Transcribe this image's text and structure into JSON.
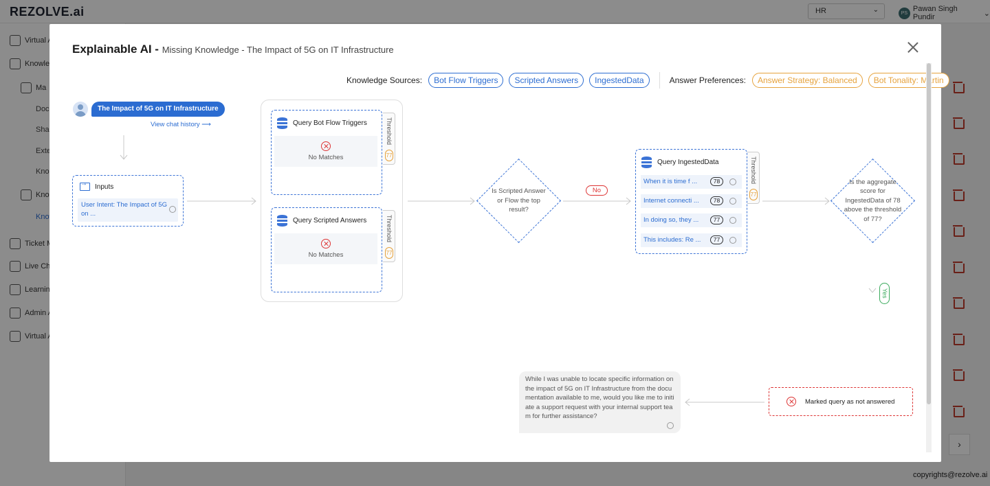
{
  "app": {
    "logo": "REZOLVE.ai",
    "workspace_select": "HR",
    "user": {
      "initials": "PS",
      "name": "Pawan Singh Pundir"
    }
  },
  "sidebar": {
    "items": [
      {
        "label": "Virtual A"
      },
      {
        "label": "Knowle"
      },
      {
        "label": "Ma"
      },
      {
        "label": "Docu"
      },
      {
        "label": "Sha"
      },
      {
        "label": "Exte"
      },
      {
        "label": "Kno"
      },
      {
        "label": "Kno"
      },
      {
        "label": "Know"
      },
      {
        "label": "Ticket M"
      },
      {
        "label": "Live Cha"
      },
      {
        "label": "Learnin"
      },
      {
        "label": "Admin A"
      },
      {
        "label": "Virtual A"
      }
    ]
  },
  "footer": {
    "copyright": "copyrights@rezolve.ai"
  },
  "modal": {
    "title": "Explainable AI - ",
    "subtitle": "Missing Knowledge - The Impact of 5G on IT Infrastructure",
    "knowledge_sources_label": "Knowledge Sources:",
    "knowledge_sources": [
      "Bot Flow Triggers",
      "Scripted Answers",
      "IngestedData"
    ],
    "answer_preferences_label": "Answer Preferences:",
    "answer_preferences": [
      "Answer Strategy: Balanced",
      "Bot Tonality: Martin"
    ],
    "query": "The Impact of 5G on IT Infrastructure",
    "view_chat_history": "View chat history",
    "inputs": {
      "title": "Inputs",
      "intent": "User Intent: The Impact of 5G on ..."
    },
    "bot_flow": {
      "title": "Query Bot Flow Triggers",
      "result": "No Matches",
      "threshold_label": "Threshold",
      "threshold": "77"
    },
    "scripted": {
      "title": "Query Scripted Answers",
      "result": "No Matches",
      "threshold_label": "Threshold",
      "threshold": "77"
    },
    "decision1": "Is Scripted Answer or Flow the top result?",
    "no_label": "No",
    "ingested": {
      "title": "Query IngestedData",
      "threshold_label": "Threshold",
      "threshold": "77",
      "rows": [
        {
          "text": "When it is time f ...",
          "score": "78"
        },
        {
          "text": "Internet connecti ...",
          "score": "78"
        },
        {
          "text": "In doing so, they ...",
          "score": "77"
        },
        {
          "text": "This includes: Re ...",
          "score": "77"
        }
      ]
    },
    "decision2": "Is the aggregate score for IngestedData of 78 above the threshold of 77?",
    "yes_label": "Yes",
    "answer": "While I was unable to locate specific information on the impact of 5G on IT Infrastructure from the documentation available to me, would you like me to initiate a support request with your internal support team for further assistance?",
    "marked": "Marked query as not answered"
  },
  "colors": {
    "accent": "#2b6cd1",
    "warning": "#e6a23c",
    "error": "#dd3333",
    "success": "#3aaa5c"
  }
}
